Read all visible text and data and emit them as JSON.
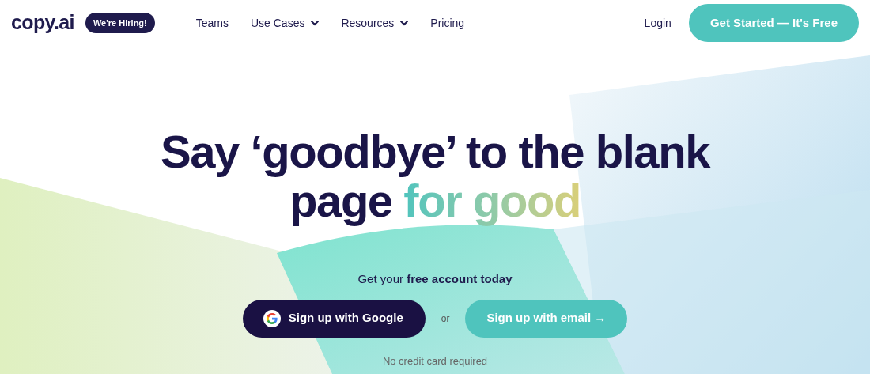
{
  "header": {
    "logo": "copy.ai",
    "badge": "We're Hiring!",
    "nav": [
      {
        "label": "Teams",
        "has_dropdown": false
      },
      {
        "label": "Use Cases",
        "has_dropdown": true
      },
      {
        "label": "Resources",
        "has_dropdown": true
      },
      {
        "label": "Pricing",
        "has_dropdown": false
      }
    ],
    "login": "Login",
    "cta": "Get Started — It's Free"
  },
  "hero": {
    "headline": {
      "line_1": "Say ‘goodbye’ to the blank",
      "line_2": "page",
      "highlight": "for good"
    },
    "subtitle": "Get your **free account today**",
    "google_button": "Sign up with Google",
    "separator": "or",
    "email_button": "Sign up with email →",
    "note": "No credit card required"
  }
}
